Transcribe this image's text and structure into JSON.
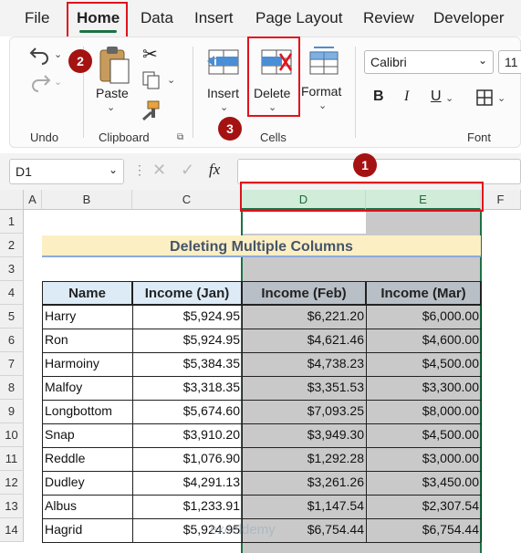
{
  "menu": {
    "tabs": [
      "File",
      "Home",
      "Data",
      "Insert",
      "Page Layout",
      "Review",
      "Developer"
    ],
    "active": "Home"
  },
  "ribbon": {
    "undo_group": "Undo",
    "clipboard": {
      "paste_label": "Paste",
      "group_label": "Clipboard"
    },
    "cells": {
      "insert_label": "Insert",
      "delete_label": "Delete",
      "format_label": "Format",
      "group_label": "Cells"
    },
    "font": {
      "family": "Calibri",
      "size": "11",
      "group_label": "Font",
      "bold": "B",
      "italic": "I",
      "underline": "U"
    }
  },
  "formula_bar": {
    "name_box": "D1",
    "fx": "fx",
    "value": ""
  },
  "grid": {
    "columns": [
      "A",
      "B",
      "C",
      "D",
      "E",
      "F"
    ],
    "selected_columns": [
      "D",
      "E"
    ],
    "rows": [
      "1",
      "2",
      "3",
      "4",
      "5",
      "6",
      "7",
      "8",
      "9",
      "10",
      "11",
      "12",
      "13",
      "14"
    ]
  },
  "table": {
    "title": "Deleting Multiple Columns",
    "headers": [
      "Name",
      "Income (Jan)",
      "Income (Feb)",
      "Income (Mar)"
    ],
    "rows": [
      [
        "Harry",
        "$5,924.95",
        "$6,221.20",
        "$6,000.00"
      ],
      [
        "Ron",
        "$5,924.95",
        "$4,621.46",
        "$4,600.00"
      ],
      [
        "Harmoiny",
        "$5,384.35",
        "$4,738.23",
        "$4,500.00"
      ],
      [
        "Malfoy",
        "$3,318.35",
        "$3,351.53",
        "$3,300.00"
      ],
      [
        "Longbottom",
        "$5,674.60",
        "$7,093.25",
        "$8,000.00"
      ],
      [
        "Snap",
        "$3,910.20",
        "$3,949.30",
        "$4,500.00"
      ],
      [
        "Reddle",
        "$1,076.90",
        "$1,292.28",
        "$3,000.00"
      ],
      [
        "Dudley",
        "$4,291.13",
        "$3,261.26",
        "$3,450.00"
      ],
      [
        "Albus",
        "$1,233.91",
        "$1,147.54",
        "$2,307.54"
      ],
      [
        "Hagrid",
        "$5,924.95",
        "$6,754.44",
        "$6,754.44"
      ]
    ]
  },
  "callouts": [
    "1",
    "2",
    "3"
  ],
  "watermark": "exceldemy",
  "colors": {
    "accent": "#1e7145",
    "callout_red": "#e0121b",
    "badge": "#a51212"
  }
}
